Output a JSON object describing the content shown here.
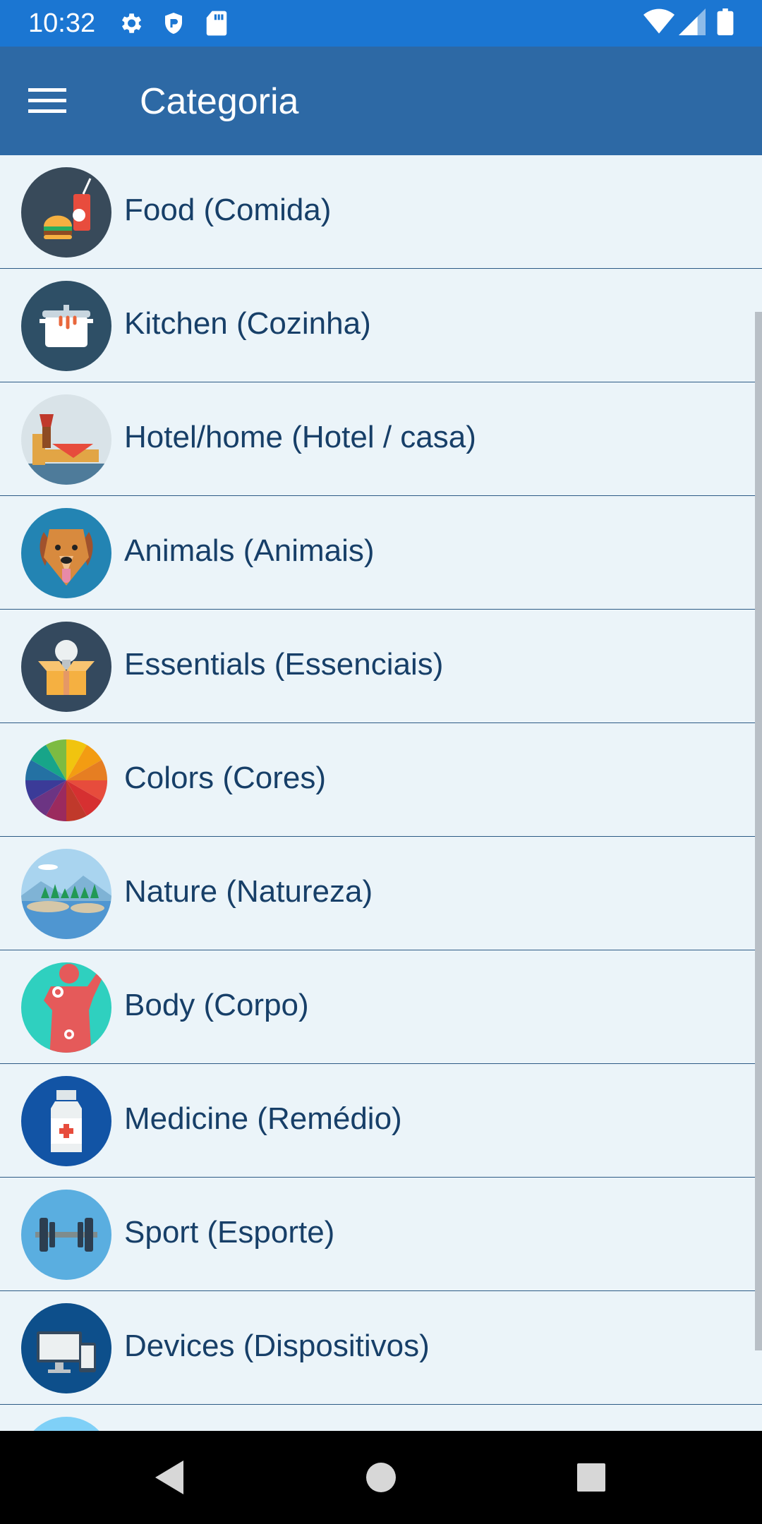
{
  "status_bar": {
    "time": "10:32",
    "icons_left": [
      "settings-icon",
      "shield-icon",
      "sd-card-icon"
    ],
    "icons_right": [
      "wifi-icon",
      "signal-icon",
      "battery-icon"
    ]
  },
  "app_bar": {
    "menu_icon": "hamburger-menu-icon",
    "title": "Categoria",
    "background": "#2d69a5"
  },
  "categories": [
    {
      "label": "Food (Comida)",
      "icon": "food-icon"
    },
    {
      "label": "Kitchen (Cozinha)",
      "icon": "kitchen-pot-icon"
    },
    {
      "label": "Hotel/home (Hotel / casa)",
      "icon": "bed-lamp-icon"
    },
    {
      "label": "Animals (Animais)",
      "icon": "dog-icon"
    },
    {
      "label": "Essentials (Essenciais)",
      "icon": "box-bulb-icon"
    },
    {
      "label": "Colors (Cores)",
      "icon": "color-wheel-icon"
    },
    {
      "label": "Nature (Natureza)",
      "icon": "landscape-icon"
    },
    {
      "label": "Body (Corpo)",
      "icon": "body-icon"
    },
    {
      "label": "Medicine (Remédio)",
      "icon": "medicine-bottle-icon"
    },
    {
      "label": "Sport (Esporte)",
      "icon": "dumbbell-icon"
    },
    {
      "label": "Devices (Dispositivos)",
      "icon": "devices-icon"
    }
  ],
  "colors": {
    "status_bar": "#1b76d2",
    "list_background": "#ebf4f9",
    "label_text": "#173f68",
    "divider": "#2c5a85"
  },
  "nav_bar": {
    "buttons": [
      "back-icon",
      "home-icon",
      "recents-icon"
    ]
  }
}
